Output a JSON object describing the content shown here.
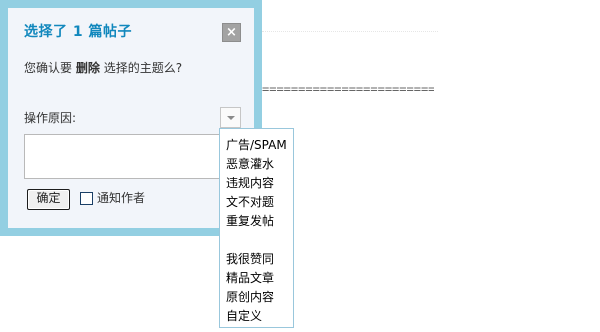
{
  "dialog": {
    "title": "选择了 1 篇帖子",
    "close_symbol": "×",
    "confirm_prefix": "您确认要",
    "confirm_action": "删除",
    "confirm_suffix": "选择的主题么?",
    "reason_label": "操作原因:",
    "reason_value": "",
    "ok_label": "确定",
    "notify_checked": false,
    "notify_label": "通知作者"
  },
  "reason_options_group1": [
    "广告/SPAM",
    "恶意灌水",
    "违规内容",
    "文不对题",
    "重复发帖"
  ],
  "reason_options_group2": [
    "我很赞同",
    "精品文章",
    "原创内容",
    "自定义"
  ],
  "background": {
    "dash_line": "========================"
  },
  "colors": {
    "dialog_border": "#93cfe2",
    "dialog_bg": "#f2f5fa",
    "title": "#1288bd",
    "dropdown_border": "#99c7dc"
  }
}
